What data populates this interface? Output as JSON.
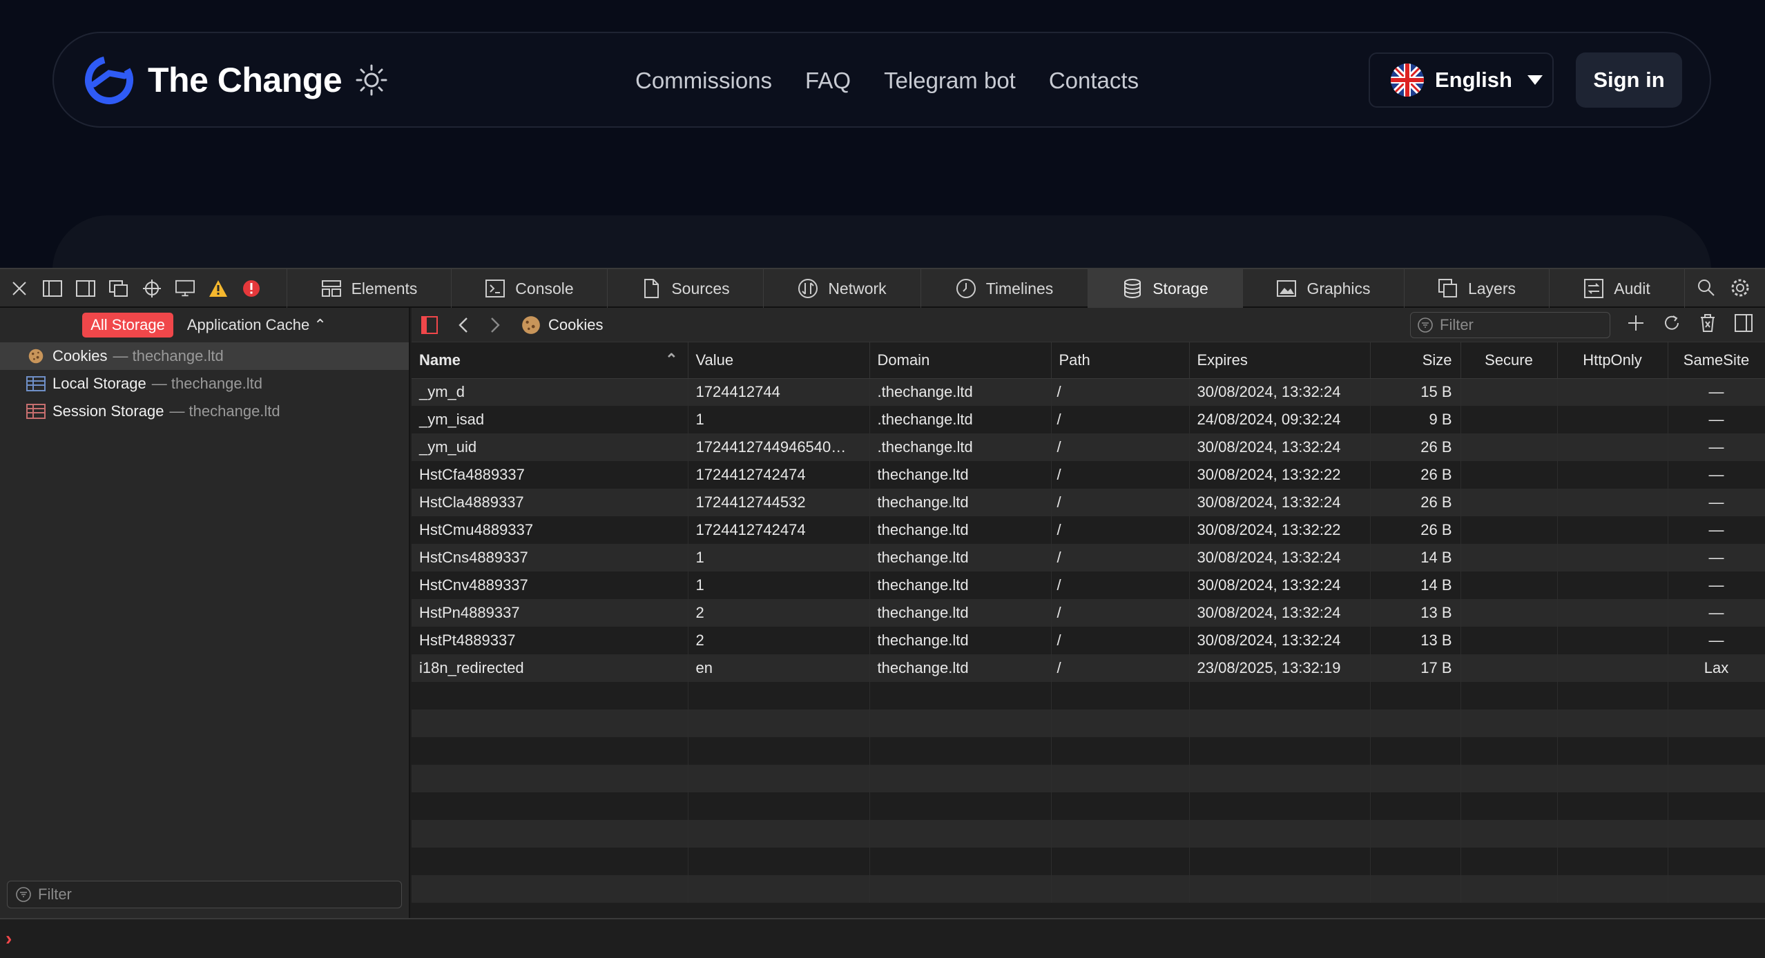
{
  "site": {
    "brand": "The Change",
    "menu": [
      "Commissions",
      "FAQ",
      "Telegram bot",
      "Contacts"
    ],
    "language": "English",
    "signin": "Sign in",
    "colors": {
      "brand_blue": "#2f5bf5",
      "bg": "#080c18"
    }
  },
  "devtools": {
    "tabs": [
      {
        "label": "Elements",
        "icon": "elements-icon"
      },
      {
        "label": "Console",
        "icon": "console-icon"
      },
      {
        "label": "Sources",
        "icon": "sources-icon"
      },
      {
        "label": "Network",
        "icon": "network-icon"
      },
      {
        "label": "Timelines",
        "icon": "timelines-icon"
      },
      {
        "label": "Storage",
        "icon": "storage-icon",
        "active": true
      },
      {
        "label": "Graphics",
        "icon": "graphics-icon"
      },
      {
        "label": "Layers",
        "icon": "layers-icon"
      },
      {
        "label": "Audit",
        "icon": "audit-icon"
      }
    ],
    "sidebar": {
      "all_storage": "All Storage",
      "app_cache": "Application Cache",
      "items": [
        {
          "label": "Cookies",
          "host": "— thechange.ltd",
          "icon": "cookie-icon"
        },
        {
          "label": "Local Storage",
          "host": "— thechange.ltd",
          "icon": "local-storage-icon"
        },
        {
          "label": "Session Storage",
          "host": "— thechange.ltd",
          "icon": "session-storage-icon"
        }
      ],
      "filter_placeholder": "Filter"
    },
    "main": {
      "breadcrumb": "Cookies",
      "filter_placeholder": "Filter",
      "columns": [
        "Name",
        "Value",
        "Domain",
        "Path",
        "Expires",
        "Size",
        "Secure",
        "HttpOnly",
        "SameSite"
      ],
      "rows": [
        [
          "_ym_d",
          "1724412744",
          ".thechange.ltd",
          "/",
          "30/08/2024, 13:32:24",
          "15 B",
          "",
          "",
          "—"
        ],
        [
          "_ym_isad",
          "1",
          ".thechange.ltd",
          "/",
          "24/08/2024, 09:32:24",
          "9 B",
          "",
          "",
          "—"
        ],
        [
          "_ym_uid",
          "1724412744946540…",
          ".thechange.ltd",
          "/",
          "30/08/2024, 13:32:24",
          "26 B",
          "",
          "",
          "—"
        ],
        [
          "HstCfa4889337",
          "1724412742474",
          "thechange.ltd",
          "/",
          "30/08/2024, 13:32:22",
          "26 B",
          "",
          "",
          "—"
        ],
        [
          "HstCla4889337",
          "1724412744532",
          "thechange.ltd",
          "/",
          "30/08/2024, 13:32:24",
          "26 B",
          "",
          "",
          "—"
        ],
        [
          "HstCmu4889337",
          "1724412742474",
          "thechange.ltd",
          "/",
          "30/08/2024, 13:32:22",
          "26 B",
          "",
          "",
          "—"
        ],
        [
          "HstCns4889337",
          "1",
          "thechange.ltd",
          "/",
          "30/08/2024, 13:32:24",
          "14 B",
          "",
          "",
          "—"
        ],
        [
          "HstCnv4889337",
          "1",
          "thechange.ltd",
          "/",
          "30/08/2024, 13:32:24",
          "14 B",
          "",
          "",
          "—"
        ],
        [
          "HstPn4889337",
          "2",
          "thechange.ltd",
          "/",
          "30/08/2024, 13:32:24",
          "13 B",
          "",
          "",
          "—"
        ],
        [
          "HstPt4889337",
          "2",
          "thechange.ltd",
          "/",
          "30/08/2024, 13:32:24",
          "13 B",
          "",
          "",
          "—"
        ],
        [
          "i18n_redirected",
          "en",
          "thechange.ltd",
          "/",
          "23/08/2025, 13:32:19",
          "17 B",
          "",
          "",
          "Lax"
        ]
      ]
    },
    "console_prompt": "›",
    "colors": {
      "accent_red": "#f0474a",
      "warning": "#f5b82e"
    }
  }
}
